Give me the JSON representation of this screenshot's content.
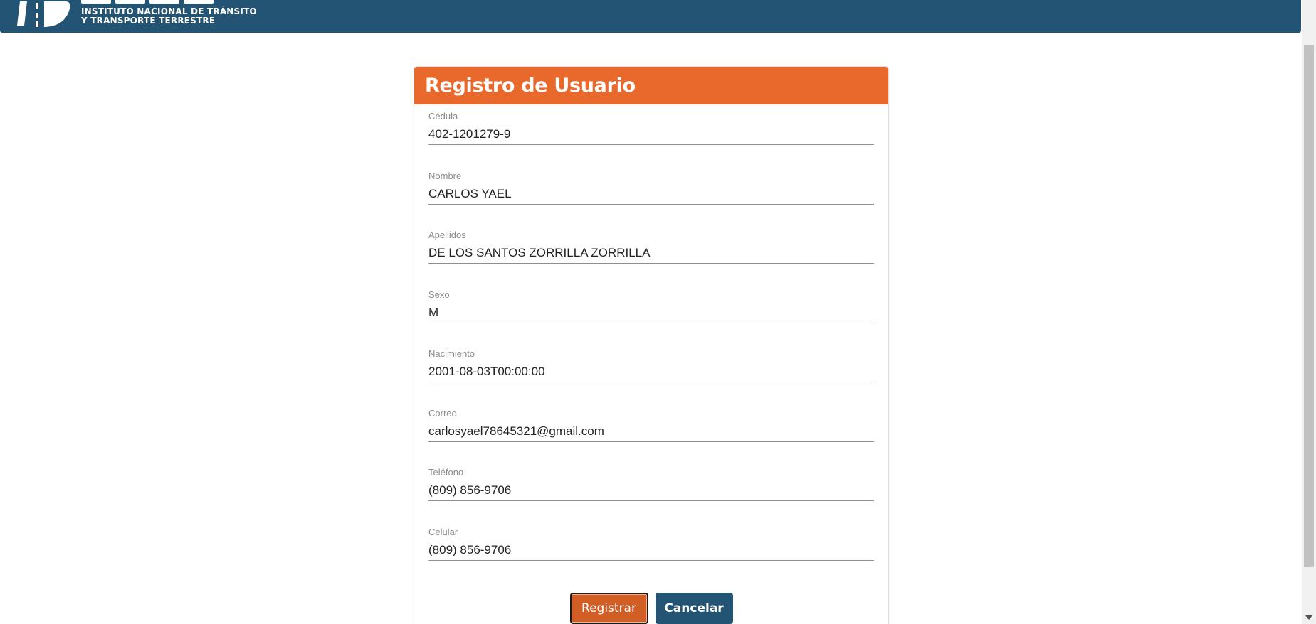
{
  "header": {
    "org_line1": "INSTITUTO NACIONAL DE TRÁNSITO",
    "org_line2": "Y TRANSPORTE TERRESTRE",
    "brand_color": "#235474"
  },
  "form": {
    "title": "Registro de Usuario",
    "accent_color": "#e9692c",
    "fields": [
      {
        "label": "Cédula",
        "value": "402-1201279-9"
      },
      {
        "label": "Nombre",
        "value": "CARLOS YAEL"
      },
      {
        "label": "Apellidos",
        "value": "DE LOS SANTOS ZORRILLA ZORRILLA"
      },
      {
        "label": "Sexo",
        "value": "M"
      },
      {
        "label": "Nacimiento",
        "value": "2001-08-03T00:00:00"
      },
      {
        "label": "Correo",
        "value": "carlosyael78645321@gmail.com"
      },
      {
        "label": "Teléfono",
        "value": "(809) 856-9706"
      },
      {
        "label": "Celular",
        "value": "(809) 856-9706"
      }
    ],
    "buttons": {
      "register_label": "Registrar",
      "cancel_label": "Cancelar"
    }
  }
}
